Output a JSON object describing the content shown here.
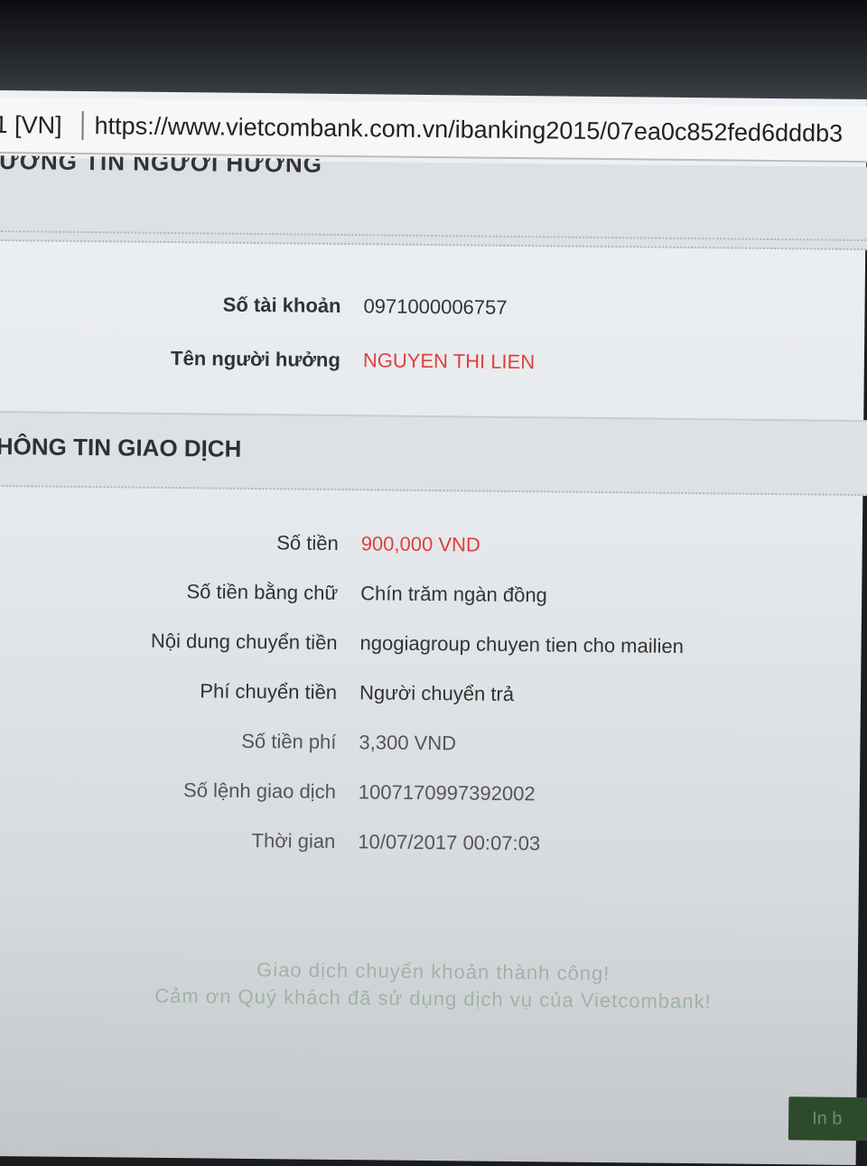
{
  "browser": {
    "lang_tab": "1 [VN]",
    "url": "https://www.vietcombank.com.vn/ibanking2015/07ea0c852fed6dddb3"
  },
  "beneficiary": {
    "heading": "ƯỜNG TIN NGƯỜI HƯỞNG",
    "account_label": "Số tài khoản",
    "account_value": "0971000006757",
    "name_label": "Tên người hưởng",
    "name_value": "NGUYEN THI LIEN"
  },
  "transaction": {
    "heading": "HÔNG TIN GIAO DỊCH",
    "rows": [
      {
        "label": "Số tiền",
        "value": "900,000 VND"
      },
      {
        "label": "Số tiền bằng chữ",
        "value": "Chín trăm ngàn đồng"
      },
      {
        "label": "Nội dung chuyển tiền",
        "value": "ngogiagroup chuyen tien cho mailien"
      },
      {
        "label": "Phí chuyển tiền",
        "value": "Người chuyển trả"
      },
      {
        "label": "Số tiền phí",
        "value": "3,300 VND"
      },
      {
        "label": "Số lệnh giao dịch",
        "value": "1007170997392002"
      },
      {
        "label": "Thời gian",
        "value": "10/07/2017 00:07:03"
      }
    ]
  },
  "message": {
    "line1": "Giao dịch chuyển khoản thành công!",
    "line2": "Cảm ơn Quý khách đã sử dụng dịch vụ của Vietcombank!"
  },
  "print_button": "In b"
}
